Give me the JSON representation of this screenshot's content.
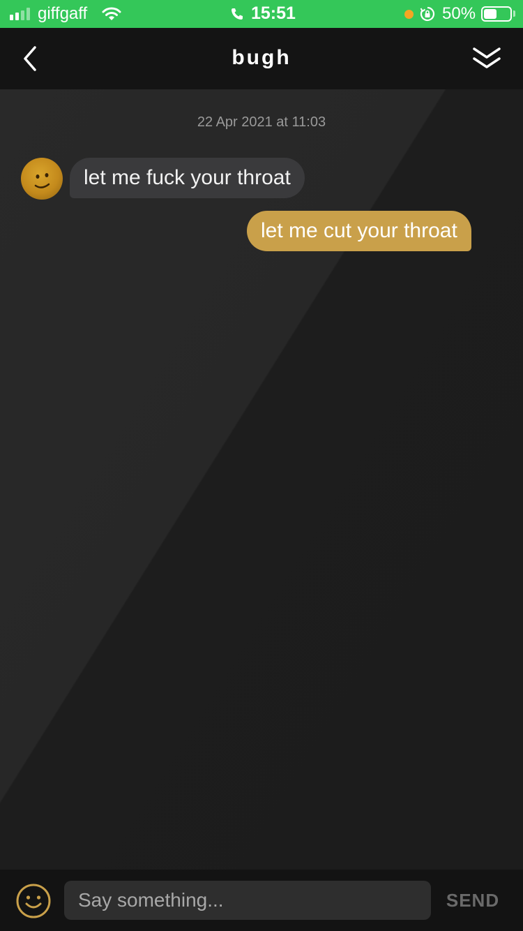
{
  "status_bar": {
    "carrier": "giffgaff",
    "time": "15:51",
    "battery_percent": "50%",
    "battery_level": 0.5,
    "signal_bars_filled": 2,
    "signal_bars_total": 4,
    "icons": [
      "signal-icon",
      "wifi-icon",
      "phone-icon",
      "orange-dot-icon",
      "rotation-lock-icon",
      "battery-icon"
    ],
    "background_color": "#34c759"
  },
  "nav": {
    "title": "bugh",
    "icons": [
      "back-chevron-icon",
      "collapse-chevron-icon"
    ]
  },
  "chat": {
    "timestamp": "22 Apr 2021 at 11:03",
    "messages": [
      {
        "direction": "incoming",
        "text": "let me fuck your throat",
        "bubble_color": "#3a3a3c"
      },
      {
        "direction": "outgoing",
        "text": "let me cut your throat",
        "bubble_color": "#c9a04a"
      }
    ]
  },
  "composer": {
    "placeholder": "Say something...",
    "value": "",
    "send_label": "SEND",
    "emoji_icon": "smiley-icon",
    "accent_color": "#c9a04a"
  }
}
